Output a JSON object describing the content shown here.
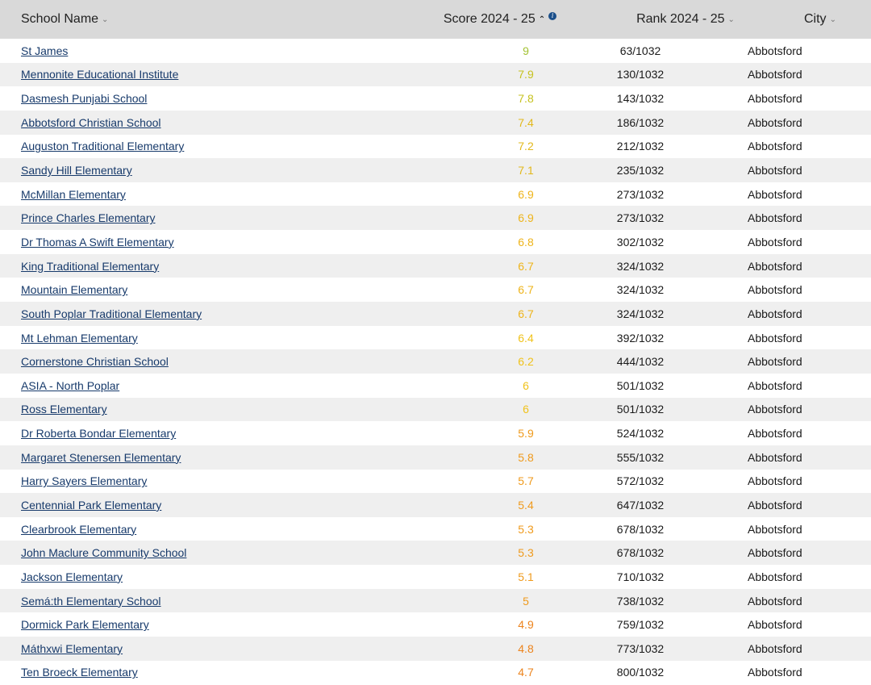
{
  "header": {
    "name": "School Name",
    "score": "Score 2024 - 25",
    "rank": "Rank 2024 - 25",
    "city": "City"
  },
  "colors": {
    "score_9": "#9ac021",
    "score_high": "#c7c41c",
    "score_7": "#e6b417",
    "score_6": "#f0c419",
    "score_5": "#ee8e1c",
    "score_4": "#eb7a1c"
  },
  "rows": [
    {
      "name": "St James",
      "score": "9",
      "rank": "63/1032",
      "city": "Abbotsford",
      "color": "#a3c233"
    },
    {
      "name": "Mennonite Educational Institute",
      "score": "7.9",
      "rank": "130/1032",
      "city": "Abbotsford",
      "color": "#c6c21f"
    },
    {
      "name": "Dasmesh Punjabi School",
      "score": "7.8",
      "rank": "143/1032",
      "city": "Abbotsford",
      "color": "#c6c21f"
    },
    {
      "name": "Abbotsford Christian School",
      "score": "7.4",
      "rank": "186/1032",
      "city": "Abbotsford",
      "color": "#e2b81b"
    },
    {
      "name": "Auguston Traditional Elementary",
      "score": "7.2",
      "rank": "212/1032",
      "city": "Abbotsford",
      "color": "#e2b81b"
    },
    {
      "name": "Sandy Hill Elementary",
      "score": "7.1",
      "rank": "235/1032",
      "city": "Abbotsford",
      "color": "#e2b81b"
    },
    {
      "name": "McMillan Elementary",
      "score": "6.9",
      "rank": "273/1032",
      "city": "Abbotsford",
      "color": "#eeb41a"
    },
    {
      "name": "Prince Charles Elementary",
      "score": "6.9",
      "rank": "273/1032",
      "city": "Abbotsford",
      "color": "#eeb41a"
    },
    {
      "name": "Dr Thomas A Swift Elementary",
      "score": "6.8",
      "rank": "302/1032",
      "city": "Abbotsford",
      "color": "#eeb41a"
    },
    {
      "name": "King Traditional Elementary",
      "score": "6.7",
      "rank": "324/1032",
      "city": "Abbotsford",
      "color": "#eeb41a"
    },
    {
      "name": "Mountain Elementary",
      "score": "6.7",
      "rank": "324/1032",
      "city": "Abbotsford",
      "color": "#eeb41a"
    },
    {
      "name": "South Poplar Traditional Elementary",
      "score": "6.7",
      "rank": "324/1032",
      "city": "Abbotsford",
      "color": "#eeb41a"
    },
    {
      "name": "Mt Lehman Elementary",
      "score": "6.4",
      "rank": "392/1032",
      "city": "Abbotsford",
      "color": "#f0c21a"
    },
    {
      "name": "Cornerstone Christian School",
      "score": "6.2",
      "rank": "444/1032",
      "city": "Abbotsford",
      "color": "#f0c21a"
    },
    {
      "name": "ASIA - North Poplar",
      "score": "6",
      "rank": "501/1032",
      "city": "Abbotsford",
      "color": "#f0c21a"
    },
    {
      "name": "Ross Elementary",
      "score": "6",
      "rank": "501/1032",
      "city": "Abbotsford",
      "color": "#f0c21a"
    },
    {
      "name": "Dr Roberta Bondar Elementary",
      "score": "5.9",
      "rank": "524/1032",
      "city": "Abbotsford",
      "color": "#ef9a1c"
    },
    {
      "name": "Margaret Stenersen Elementary",
      "score": "5.8",
      "rank": "555/1032",
      "city": "Abbotsford",
      "color": "#ef9a1c"
    },
    {
      "name": "Harry Sayers Elementary",
      "score": "5.7",
      "rank": "572/1032",
      "city": "Abbotsford",
      "color": "#ef9a1c"
    },
    {
      "name": "Centennial Park Elementary",
      "score": "5.4",
      "rank": "647/1032",
      "city": "Abbotsford",
      "color": "#ef9a1c"
    },
    {
      "name": "Clearbrook Elementary",
      "score": "5.3",
      "rank": "678/1032",
      "city": "Abbotsford",
      "color": "#ef9a1c"
    },
    {
      "name": "John Maclure Community School",
      "score": "5.3",
      "rank": "678/1032",
      "city": "Abbotsford",
      "color": "#ef9a1c"
    },
    {
      "name": "Jackson Elementary",
      "score": "5.1",
      "rank": "710/1032",
      "city": "Abbotsford",
      "color": "#ef9a1c"
    },
    {
      "name": "Semá:th Elementary School",
      "score": "5",
      "rank": "738/1032",
      "city": "Abbotsford",
      "color": "#ef9a1c"
    },
    {
      "name": "Dormick Park Elementary",
      "score": "4.9",
      "rank": "759/1032",
      "city": "Abbotsford",
      "color": "#ec831c"
    },
    {
      "name": "Máthxwi Elementary",
      "score": "4.8",
      "rank": "773/1032",
      "city": "Abbotsford",
      "color": "#ec831c"
    },
    {
      "name": "Ten Broeck Elementary",
      "score": "4.7",
      "rank": "800/1032",
      "city": "Abbotsford",
      "color": "#ec831c"
    }
  ]
}
